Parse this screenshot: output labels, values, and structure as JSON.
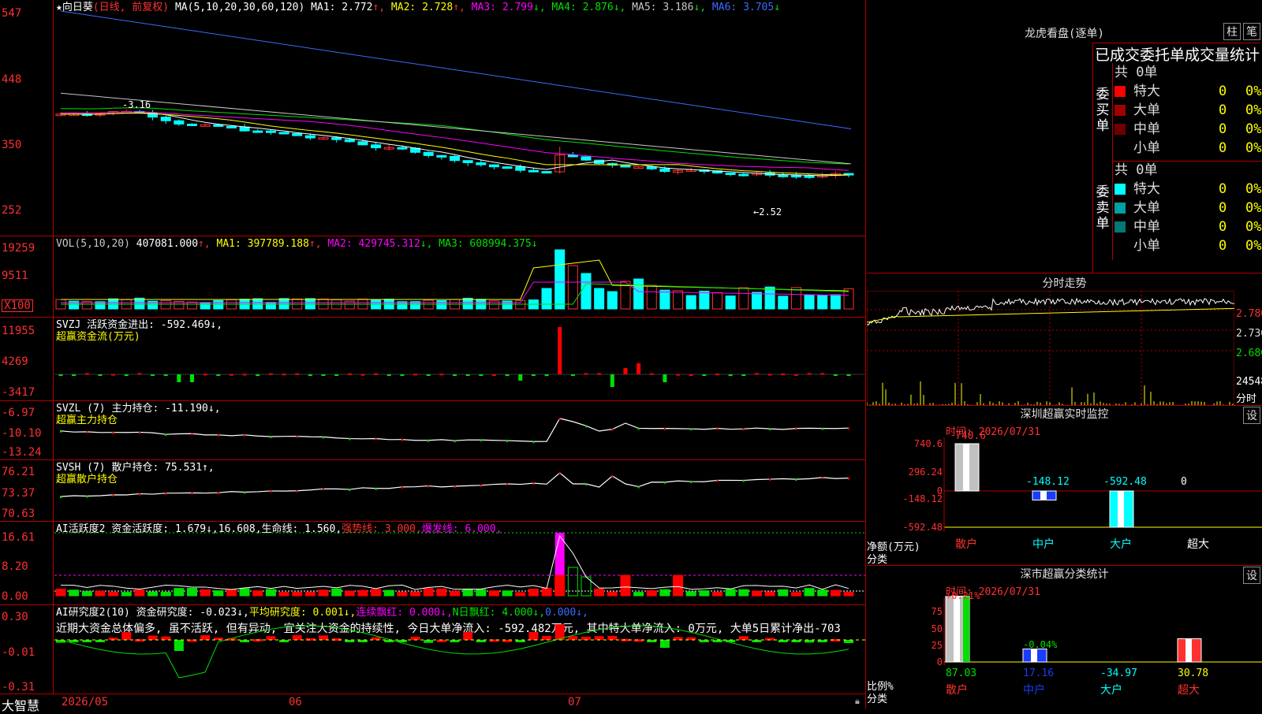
{
  "brand": "大智慧",
  "date_axis": {
    "labels": [
      "2026/05",
      "06",
      "07"
    ]
  },
  "main_pane": {
    "stock_title": "★向日葵",
    "period": "(日线, 前复权)",
    "ma_label": "MA(5,10,20,30,60,120)",
    "ma_values": [
      {
        "label": "MA1: 2.772",
        "arrow": "↑",
        "color": "#ffffff"
      },
      {
        "label": "MA2: 2.728",
        "arrow": "↑",
        "color": "#ffff00"
      },
      {
        "label": "MA3: 2.799",
        "arrow": "↓",
        "color": "#ff00ff"
      },
      {
        "label": "MA4: 2.876",
        "arrow": "↓",
        "color": "#00e000"
      },
      {
        "label": "MA5: 3.186",
        "arrow": "↓",
        "color": "#c8c8c8"
      },
      {
        "label": "MA6: 3.705",
        "arrow": "↓",
        "color": "#3a6bff"
      }
    ],
    "y_ticks": [
      "547",
      "448",
      "350",
      "252"
    ],
    "high_label": "-3.16",
    "low_label": "←2.52"
  },
  "vol_pane": {
    "title": "VOL(5,10,20)",
    "value": "407081.000",
    "ma_values": [
      {
        "label": "MA1: 397789.188",
        "arrow": "↑",
        "color": "#ffff00"
      },
      {
        "label": "MA2: 429745.312",
        "arrow": "↓",
        "color": "#ff00ff"
      },
      {
        "label": "MA3: 608994.375",
        "arrow": "↓",
        "color": "#00e000"
      }
    ],
    "y_ticks": [
      "19259",
      "9511",
      "X100"
    ]
  },
  "svzj_pane": {
    "title": "SVZJ  活跃资金进出: -592.469↓,",
    "subtitle": "超赢资金流(万元)",
    "y_ticks": [
      "11955",
      "4269",
      "-3417"
    ]
  },
  "svzl_pane": {
    "title": "SVZL (7) 主力持仓: -11.190↓,",
    "subtitle": "超赢主力持仓",
    "y_ticks": [
      "-6.97",
      "-10.10",
      "-13.24"
    ]
  },
  "svsh_pane": {
    "title": "SVSH (7) 散户持仓: 75.531↑,",
    "subtitle": "超赢散户持仓",
    "y_ticks": [
      "76.21",
      "73.37",
      "70.63"
    ]
  },
  "ai_pane": {
    "title_a": "AI活跃度2 资金活跃度: 1.679↓,16.608,生命线: 1.560,",
    "title_b": "强势线: 3.000,",
    "title_c": "爆发线: 6.000,",
    "y_ticks": [
      "16.61",
      "8.20",
      "0.00"
    ]
  },
  "research_pane": {
    "title_a": "AI研究度2(10) 资金研究度: -0.023↓,",
    "title_b": "平均研究度: 0.001↓,",
    "title_c": "连续飘红: 0.000↓,",
    "title_d": "N日飘红: 4.000↓,",
    "title_e": "0.000↓,",
    "comment": "近期大资金总体偏多, 虽不活跃, 但有异动, 宜关注大资金的持续性, 今日大单净流入: -592.482万元, 其中特大单净流入: 0万元, 大单5日累计净出-703",
    "y_ticks": [
      "0.30",
      "-0.01",
      "-0.31"
    ]
  },
  "dragon_panel": {
    "title": "龙虎看盘(逐单)",
    "btn_a": "柱",
    "btn_b": "笔",
    "subtitle": "已成交委托单成交量统计",
    "buy_label": "委买单",
    "sell_label": "委卖单",
    "buy_total": "共 0单",
    "sell_total": "共 0单",
    "buy_rows": [
      {
        "name": "特大",
        "count": "0",
        "pct": "0%",
        "color": "#ff0000"
      },
      {
        "name": "大单",
        "count": "0",
        "pct": "0%",
        "color": "#a00000"
      },
      {
        "name": "中单",
        "count": "0",
        "pct": "0%",
        "color": "#700000"
      },
      {
        "name": "小单",
        "count": "0",
        "pct": "0%",
        "color": "#000000"
      }
    ],
    "sell_rows": [
      {
        "name": "特大",
        "count": "0",
        "pct": "0%",
        "color": "#00ffff"
      },
      {
        "name": "大单",
        "count": "0",
        "pct": "0%",
        "color": "#00a0a0"
      },
      {
        "name": "中单",
        "count": "0",
        "pct": "0%",
        "color": "#007878"
      },
      {
        "name": "小单",
        "count": "0",
        "pct": "0%",
        "color": "#000000"
      }
    ]
  },
  "intraday_panel": {
    "title": "分时走势",
    "price_ticks": [
      "2.780",
      "2.730",
      "2.680"
    ],
    "vol_tick": "24548",
    "vol_label": "分时"
  },
  "sz_monitor": {
    "title": "深圳超赢实时监控",
    "btn": "设",
    "time": "时间: 2026/07/31",
    "y_ticks": [
      "740.6",
      "296.24",
      "0",
      "-148.12",
      "-592.48"
    ],
    "unit_label": "净额(万元)",
    "cat_label": "分类",
    "categories": [
      "散户",
      "中户",
      "大户",
      "超大"
    ],
    "values": [
      "740.6",
      "-148.12",
      "-592.48",
      "0"
    ]
  },
  "sz_stats": {
    "title": "深市超赢分类统计",
    "btn": "设",
    "time": "时间: 2026/07/31",
    "y_ticks": [
      "75",
      "50",
      "25",
      "0"
    ],
    "unit_label": "比例%",
    "cat_label": "分类",
    "categories": [
      "散户",
      "中户",
      "大户",
      "超大"
    ],
    "top_labels": [
      "+0.21%",
      "-0.04%"
    ],
    "values": [
      "87.03",
      "17.16",
      "-34.97",
      "30.78"
    ]
  }
}
